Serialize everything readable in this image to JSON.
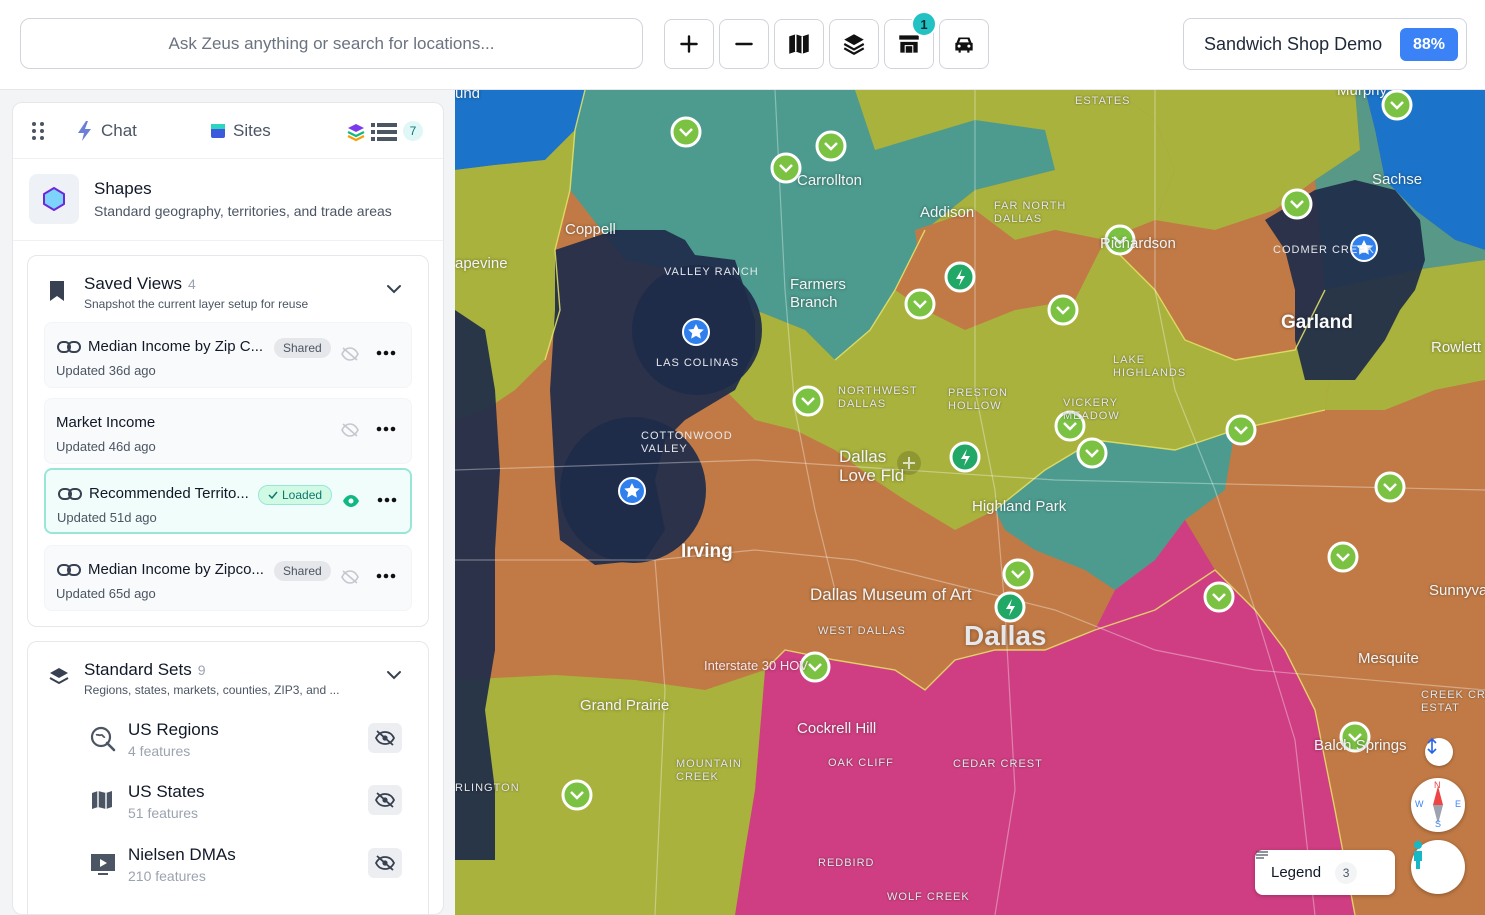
{
  "header": {
    "search_placeholder": "Ask Zeus anything or search for locations...",
    "tools": [
      {
        "name": "zoom-in-button",
        "icon": "plus-icon"
      },
      {
        "name": "zoom-out-button",
        "icon": "minus-icon"
      },
      {
        "name": "basemap-button",
        "icon": "map-icon"
      },
      {
        "name": "layers-button",
        "icon": "layers-icon"
      },
      {
        "name": "stores-button",
        "icon": "store-icon",
        "badge": "1"
      },
      {
        "name": "drive-time-button",
        "icon": "car-icon"
      }
    ],
    "store_badge": "1",
    "project_name": "Sandwich Shop Demo",
    "project_pct": "88%"
  },
  "panel": {
    "tabs": {
      "chat": "Chat",
      "sites": "Sites",
      "sites_count": "7"
    },
    "shapes": {
      "title": "Shapes",
      "subtitle": "Standard geography, territories, and trade areas"
    },
    "saved_views": {
      "title": "Saved Views",
      "count": "4",
      "subtitle": "Snapshot the current layer setup for reuse",
      "items": [
        {
          "title": "Median Income by Zip C...",
          "badge": "Shared",
          "updated": "Updated 36d ago",
          "linked": true,
          "visible": false
        },
        {
          "title": "Market Income",
          "badge": "",
          "updated": "Updated 46d ago",
          "linked": false,
          "visible": false
        },
        {
          "title": "Recommended Territo...",
          "badge": "Loaded",
          "updated": "Updated 51d ago",
          "linked": true,
          "visible": true
        },
        {
          "title": "Median Income by Zipco...",
          "badge": "Shared",
          "updated": "Updated 65d ago",
          "linked": true,
          "visible": false
        }
      ]
    },
    "standard_sets": {
      "title": "Standard Sets",
      "count": "9",
      "subtitle": "Regions, states, markets, counties, ZIP3, and ...",
      "items": [
        {
          "title": "US Regions",
          "sub": "4 features",
          "icon": "region-search-icon"
        },
        {
          "title": "US States",
          "sub": "51 features",
          "icon": "map-icon"
        },
        {
          "title": "Nielsen DMAs",
          "sub": "210 features",
          "icon": "tv-play-icon"
        }
      ]
    }
  },
  "map": {
    "labels": {
      "carrollton": "Carrollton",
      "coppell": "Coppell",
      "addison": "Addison",
      "far_north_dallas": "FAR NORTH\nDALLAS",
      "richardson": "Richardson",
      "valley_ranch": "VALLEY RANCH",
      "farmers_branch": "Farmers\nBranch",
      "las_colinas": "LAS COLINAS",
      "grapevine": "apevine",
      "northwest_dallas": "NORTHWEST\nDALLAS",
      "preston_hollow": "PRESTON\nHOLLOW",
      "vickery_meadow": "VICKERY\nMEADOW",
      "lake_highlands": "LAKE\nHIGHLANDS",
      "cottonwood_valley": "COTTONWOOD\nVALLEY",
      "dallas_love_field": "Dallas\nLove Fld",
      "highland_park": "Highland Park",
      "irving": "Irving",
      "dallas_museum": "Dallas Museum of Art",
      "dallas": "Dallas",
      "west_dallas": "WEST DALLAS",
      "interstate": "Interstate 30 HOV",
      "grand_prairie": "Grand Prairie",
      "cockrell_hill": "Cockrell Hill",
      "mountain_creek": "MOUNTAIN\nCREEK",
      "oak_cliff": "OAK CLIFF",
      "cedar_crest": "CEDAR CREST",
      "redbird": "REDBIRD",
      "wolf_creek": "WOLF CREEK",
      "arlington": "RLINGTON",
      "garland": "Garland",
      "sachse": "Sachse",
      "murphy": "Murphy",
      "rowlett": "Rowlett",
      "sunnyvale": "Sunnyva",
      "mesquite": "Mesquite",
      "balch_springs": "Balch Springs",
      "creek_crossing": "CREEK CRO\nESTAT",
      "comer": "CODMER CREEK",
      "estates": "ESTATES",
      "north_tip": "und"
    },
    "legend_label": "Legend",
    "legend_count": "3",
    "compass": {
      "n": "N",
      "s": "S",
      "e": "E",
      "w": "W"
    },
    "colors": {
      "olive": "#a9b23c",
      "teal": "#4c9b8e",
      "brown": "#c17a45",
      "magenta": "#cf3e82",
      "navy": "#1e2b4a",
      "blue": "#1b74c9"
    }
  }
}
